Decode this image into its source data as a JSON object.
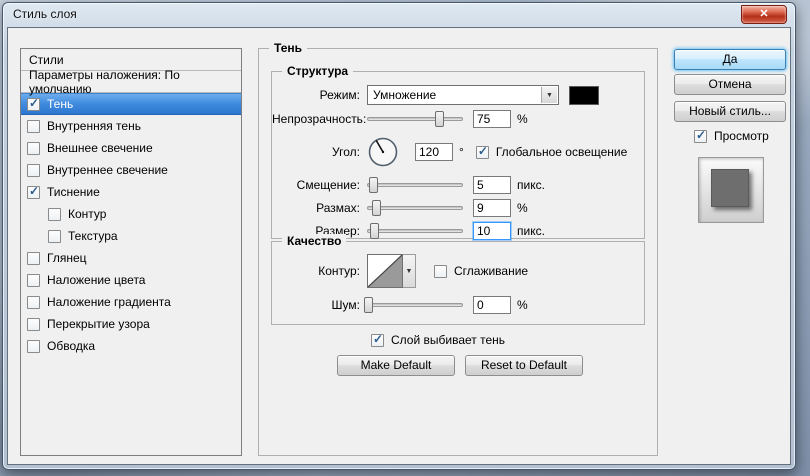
{
  "window": {
    "title": "Стиль слоя"
  },
  "icons": {
    "close": "✕",
    "dropdown": "▼",
    "check": "✓"
  },
  "sidebar": {
    "header": "Стили",
    "blending": "Параметры наложения: По умолчанию",
    "items": [
      {
        "label": "Тень",
        "checked": true,
        "selected": true
      },
      {
        "label": "Внутренняя тень",
        "checked": false
      },
      {
        "label": "Внешнее свечение",
        "checked": false
      },
      {
        "label": "Внутреннее свечение",
        "checked": false
      },
      {
        "label": "Тиснение",
        "checked": true
      },
      {
        "label": "Контур",
        "checked": false,
        "indent": true
      },
      {
        "label": "Текстура",
        "checked": false,
        "indent": true
      },
      {
        "label": "Глянец",
        "checked": false
      },
      {
        "label": "Наложение цвета",
        "checked": false
      },
      {
        "label": "Наложение градиента",
        "checked": false
      },
      {
        "label": "Перекрытие узора",
        "checked": false
      },
      {
        "label": "Обводка",
        "checked": false
      }
    ]
  },
  "main": {
    "group_title": "Тень",
    "structure": {
      "title": "Структура",
      "mode_label": "Режим:",
      "mode_value": "Умножение",
      "swatch_color": "#000000",
      "opacity_label": "Непрозрачность:",
      "opacity_value": "75",
      "opacity_unit": "%",
      "angle_label": "Угол:",
      "angle_value": "120",
      "angle_unit": "°",
      "global_light_label": "Глобальное освещение",
      "global_light_checked": true,
      "distance_label": "Смещение:",
      "distance_value": "5",
      "distance_unit": "пикс.",
      "spread_label": "Размах:",
      "spread_value": "9",
      "spread_unit": "%",
      "size_label": "Размер:",
      "size_value": "10",
      "size_unit": "пикс."
    },
    "quality": {
      "title": "Качество",
      "contour_label": "Контур:",
      "antialias_label": "Сглаживание",
      "antialias_checked": false,
      "noise_label": "Шум:",
      "noise_value": "0",
      "noise_unit": "%"
    },
    "knockout_label": "Слой выбивает тень",
    "knockout_checked": true,
    "make_default": "Make Default",
    "reset_default": "Reset to Default"
  },
  "actions": {
    "ok": "Да",
    "cancel": "Отмена",
    "new_style": "Новый стиль...",
    "preview_label": "Просмотр",
    "preview_checked": true
  },
  "colors": {
    "selection": "#3f8ade",
    "preview_fill": "#6e6e6e"
  }
}
